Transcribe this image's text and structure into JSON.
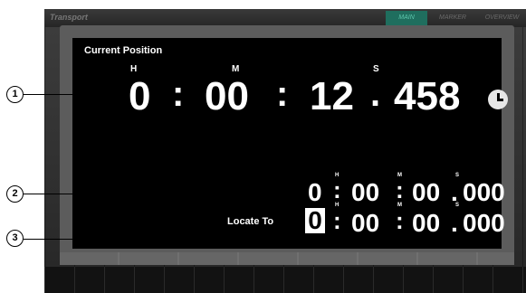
{
  "header": {
    "title": "Transport",
    "tabs": [
      {
        "label": "MAIN",
        "active": true
      },
      {
        "label": "MARKER",
        "active": false
      },
      {
        "label": "OVERVIEW",
        "active": false
      }
    ]
  },
  "current_position": {
    "label": "Current Position",
    "units": {
      "h": "H",
      "m": "M",
      "s": "S"
    },
    "hours": "0",
    "minutes": "00",
    "seconds": "12",
    "milliseconds": "458"
  },
  "secondary_position": {
    "units": {
      "h": "H",
      "m": "M",
      "s": "S"
    },
    "hours": "0",
    "minutes": "00",
    "seconds": "00",
    "milliseconds": "000"
  },
  "locate_to": {
    "label": "Locate To",
    "units": {
      "h": "H",
      "m": "M",
      "s": "S"
    },
    "hours": "0",
    "minutes": "00",
    "seconds": "00",
    "milliseconds": "000"
  },
  "callouts": [
    "1",
    "2",
    "3"
  ],
  "icons": {
    "clock": "clock-icon"
  },
  "colors": {
    "active_tab": "#1f6e5e",
    "active_tab_text": "#5ec7ad",
    "screen_bg": "#000000"
  }
}
